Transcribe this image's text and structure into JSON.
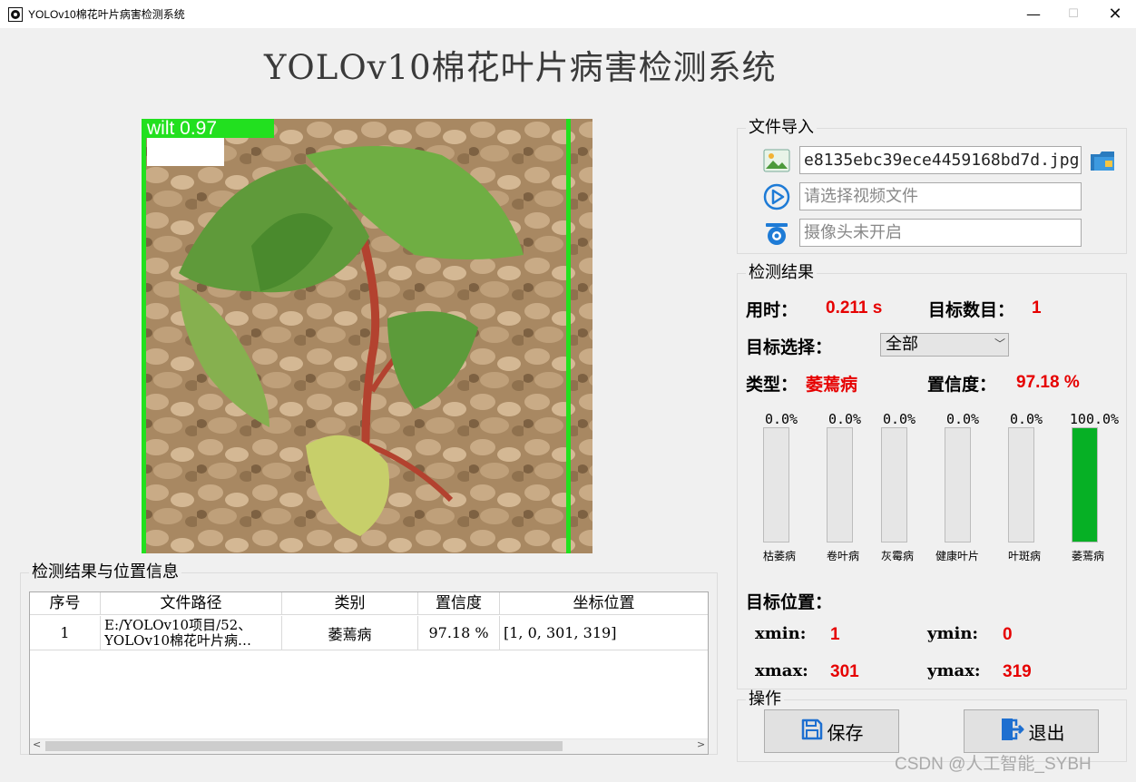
{
  "window": {
    "title": "YOLOv10棉花叶片病害检测系统",
    "minimize": "—",
    "maximize": "☐",
    "close": "✕"
  },
  "main_title": "YOLOv10棉花叶片病害检测系统",
  "detection_label": "wilt 0.97",
  "table_group": {
    "title": "检测结果与位置信息",
    "columns": [
      "序号",
      "文件路径",
      "类别",
      "置信度",
      "坐标位置"
    ],
    "rows": [
      {
        "index": "1",
        "path_line1": "E:/YOLOv10项目/52、",
        "path_line2": "YOLOv10棉花叶片病…",
        "category": "萎蔫病",
        "confidence": "97.18 %",
        "position": "[1, 0, 301, 319]"
      }
    ]
  },
  "import_group": {
    "title": "文件导入",
    "image_value": "e8135ebc39ece4459168bd7d.jpg",
    "video_placeholder": "请选择视频文件",
    "camera_placeholder": "摄像头未开启"
  },
  "result_group": {
    "title": "检测结果",
    "time_label": "用时：",
    "time_value": "0.211 s",
    "count_label": "目标数目：",
    "count_value": "1",
    "select_label": "目标选择：",
    "select_value": "全部",
    "type_label": "类型：",
    "type_value": "萎蔫病",
    "conf_label": "置信度：",
    "conf_value": "97.18 %",
    "bars": [
      {
        "name": "枯萎病",
        "pct_text": "0.0%",
        "value": 0.0
      },
      {
        "name": "卷叶病",
        "pct_text": "0.0%",
        "value": 0.0
      },
      {
        "name": "灰霉病",
        "pct_text": "0.0%",
        "value": 0.0
      },
      {
        "name": "健康叶片",
        "pct_text": "0.0%",
        "value": 0.0
      },
      {
        "name": "叶斑病",
        "pct_text": "0.0%",
        "value": 0.0
      },
      {
        "name": "萎蔫病",
        "pct_text": "100.0%",
        "value": 100.0
      }
    ],
    "bar_color": "#06b025",
    "position_label": "目标位置：",
    "xmin_label": "xmin:",
    "xmin_value": "1",
    "ymin_label": "ymin:",
    "ymin_value": "0",
    "xmax_label": "xmax:",
    "xmax_value": "301",
    "ymax_label": "ymax:",
    "ymax_value": "319"
  },
  "ops_group": {
    "title": "操作",
    "save_label": "保存",
    "exit_label": "退出"
  },
  "watermark": "CSDN @人工智能_SYBH",
  "colors": {
    "accent_red": "#e60000",
    "detect_green": "#22e01f"
  }
}
